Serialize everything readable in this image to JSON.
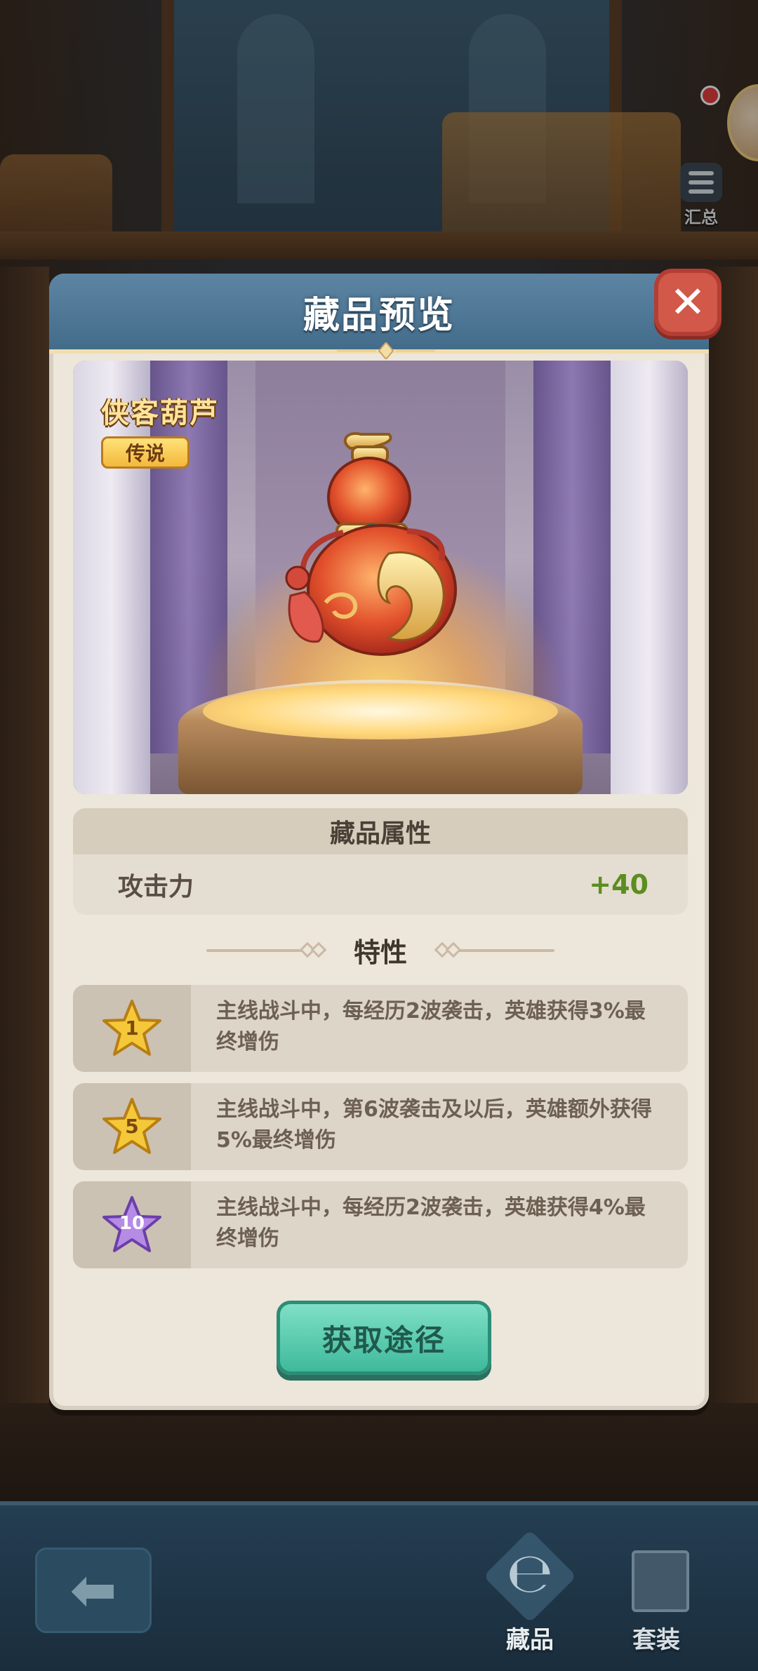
{
  "topbar": {
    "summary_label": "汇总"
  },
  "dialog": {
    "title": "藏品预览",
    "item_name": "侠客葫芦",
    "rarity": "传说",
    "attributes": {
      "title": "藏品属性",
      "rows": [
        {
          "name": "攻击力",
          "value": "+40"
        }
      ]
    },
    "traits": {
      "title": "特性",
      "items": [
        {
          "star": "1",
          "star_color": "#f5c83a",
          "text": "主线战斗中，每经历2波袭击，英雄获得3%最终增伤"
        },
        {
          "star": "5",
          "star_color": "#f5c83a",
          "text": "主线战斗中，第6波袭击及以后，英雄额外获得5%最终增伤"
        },
        {
          "star": "10",
          "star_color": "#b58be6",
          "text": "主线战斗中，每经历2波袭击，英雄获得4%最终增伤"
        }
      ]
    },
    "obtain_button": "获取途径"
  },
  "bottom_nav": {
    "tabs": [
      {
        "label": "藏品",
        "icon": "collection-icon"
      },
      {
        "label": "套装",
        "icon": "book-icon"
      }
    ]
  },
  "colors": {
    "header_blue": "#4f7897",
    "attr_value_green": "#5c8d1f",
    "obtain_button": "#4cc4a4",
    "close_button": "#d25849"
  }
}
